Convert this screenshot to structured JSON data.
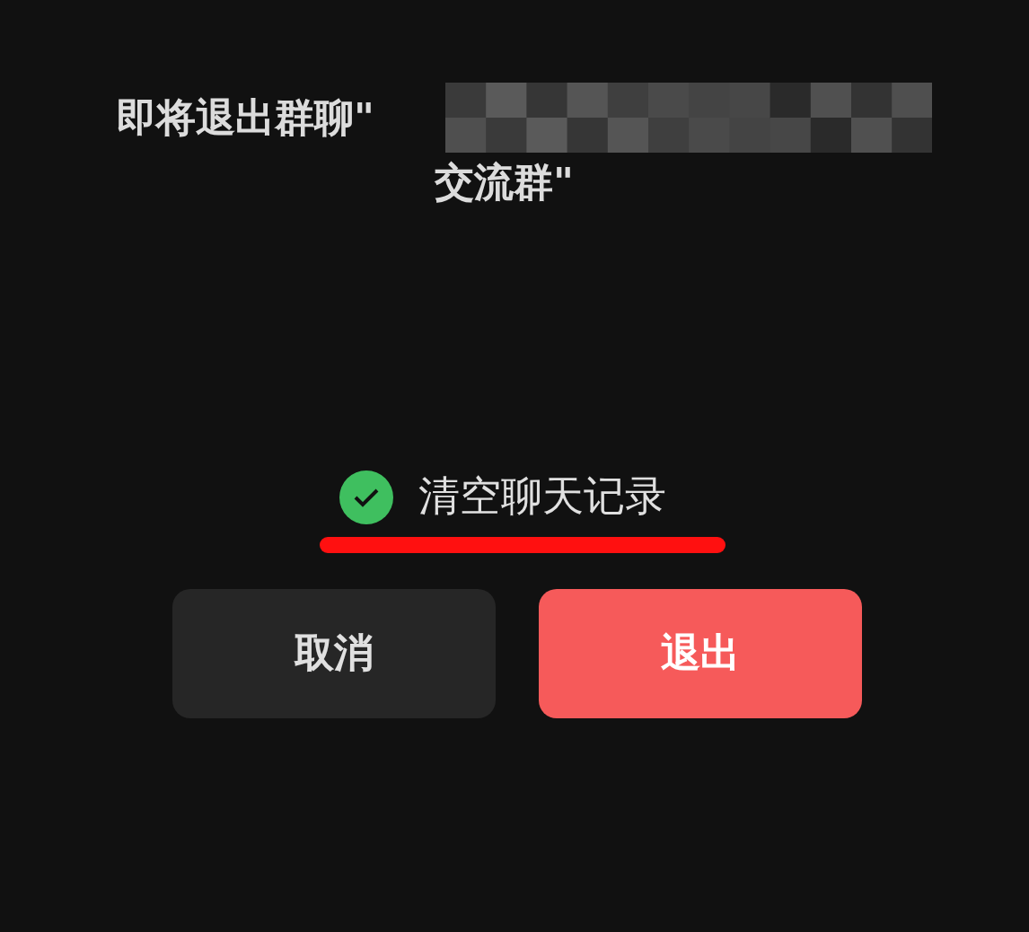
{
  "title": {
    "start": "即将退出群聊\"",
    "end": "交流群\""
  },
  "option": {
    "label": "清空聊天记录",
    "checked": true
  },
  "buttons": [
    {
      "label": "取消",
      "kind": "cancel"
    },
    {
      "label": "退出",
      "kind": "confirm"
    }
  ]
}
